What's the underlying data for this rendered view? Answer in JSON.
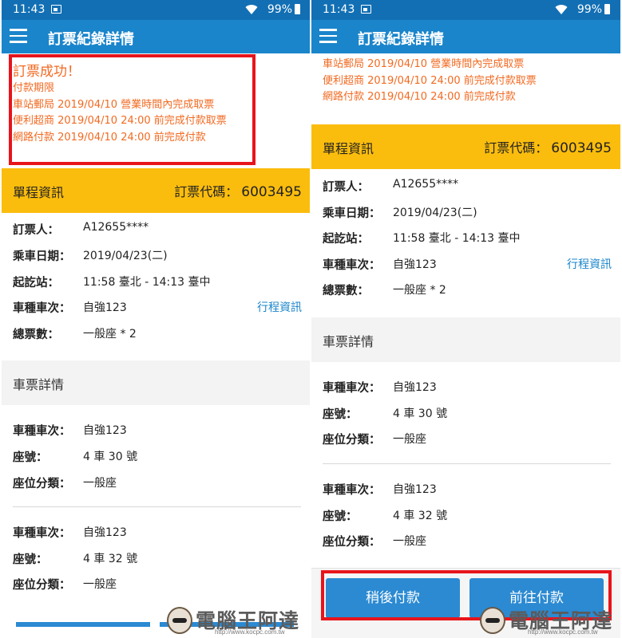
{
  "status_bar": {
    "time": "11:43",
    "battery": "99%"
  },
  "app_bar": {
    "title": "訂票紀錄詳情"
  },
  "notice": {
    "heading": "訂票成功！",
    "deadline_label": "付款期限",
    "lines": [
      "車站郵局 2019/04/10 營業時間內完成取票",
      "便利超商 2019/04/10 24:00 前完成付款取票",
      "網路付款 2019/04/10 24:00 前完成付款"
    ]
  },
  "trip": {
    "section_label": "單程資訊",
    "code_label": "訂票代碼：",
    "code_value": "6003495",
    "rows": [
      {
        "key": "訂票人：",
        "value": "A12655****"
      },
      {
        "key": "乘車日期：",
        "value": "2019/04/23(二)"
      },
      {
        "key": "起訖站：",
        "value": "11:58 臺北 - 14:13 臺中"
      },
      {
        "key": "車種車次：",
        "value": "自強123",
        "link": "行程資訊"
      },
      {
        "key": "總票數：",
        "value": "一般座 * 2"
      }
    ]
  },
  "ticket_details": {
    "section_label": "車票詳情",
    "tickets": [
      [
        {
          "key": "車種車次：",
          "value": "自強123"
        },
        {
          "key": "座號：",
          "value": "4 車 30 號"
        },
        {
          "key": "座位分類：",
          "value": "一般座"
        }
      ],
      [
        {
          "key": "車種車次：",
          "value": "自強123"
        },
        {
          "key": "座號：",
          "value": "4 車 32 號"
        },
        {
          "key": "座位分類：",
          "value": "一般座"
        }
      ]
    ]
  },
  "actions": {
    "pay_later": "稍後付款",
    "pay_now": "前往付款"
  },
  "watermark": {
    "brand": "電腦王阿達",
    "url": "http://www.kocpc.com.tw"
  },
  "colors": {
    "primary": "#1a85cb",
    "status_bar": "#126fb4",
    "accent_yellow": "#fbbd0d",
    "notice_orange": "#f26a21",
    "highlight_red": "#e8141b"
  }
}
